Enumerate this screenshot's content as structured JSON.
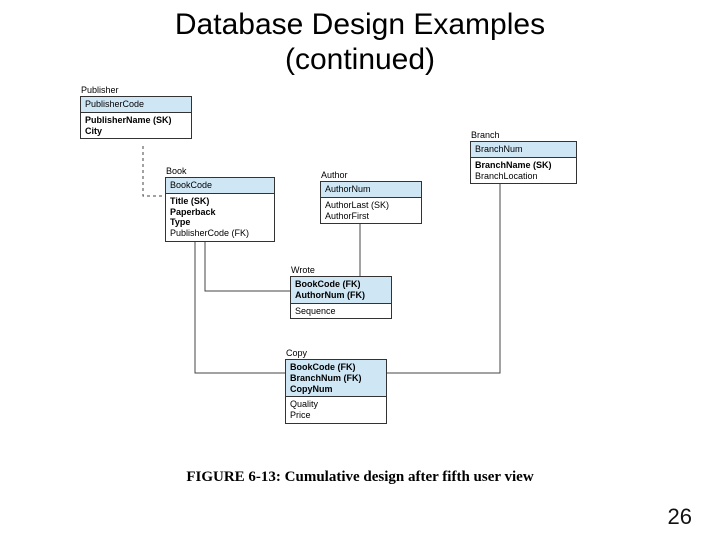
{
  "title_line1": "Database Design Examples",
  "title_line2": "(continued)",
  "figure_caption": "FIGURE 6-13: Cumulative design after fifth user view",
  "page_number": "26",
  "entities": {
    "publisher": {
      "name": "Publisher",
      "pk": "PublisherCode",
      "attr1": "PublisherName (SK)",
      "attr2": "City"
    },
    "book": {
      "name": "Book",
      "pk": "BookCode",
      "attr1": "Title (SK)",
      "attr2": "Paperback",
      "attr3": "Type",
      "attr4": "PublisherCode (FK)"
    },
    "author": {
      "name": "Author",
      "pk": "AuthorNum",
      "attr1": "AuthorLast (SK)",
      "attr2": "AuthorFirst"
    },
    "branch": {
      "name": "Branch",
      "pk": "BranchNum",
      "attr1": "BranchName (SK)",
      "attr2": "BranchLocation"
    },
    "wrote": {
      "name": "Wrote",
      "pk1": "BookCode (FK)",
      "pk2": "AuthorNum (FK)",
      "attr1": "Sequence"
    },
    "copy": {
      "name": "Copy",
      "pk1": "BookCode (FK)",
      "pk2": "BranchNum (FK)",
      "pk3": "CopyNum",
      "attr1": "Quality",
      "attr2": "Price"
    }
  }
}
